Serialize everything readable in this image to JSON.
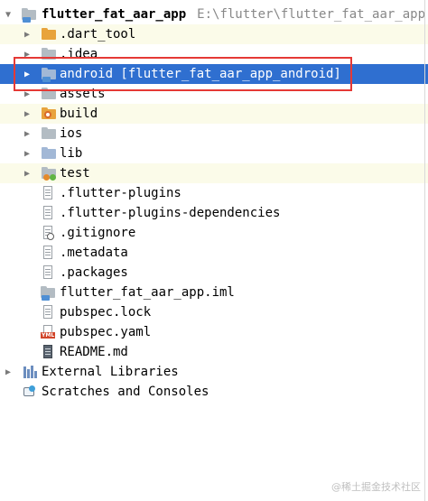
{
  "project_tree": {
    "root": {
      "name": "flutter_fat_aar_app",
      "path": "E:\\flutter\\flutter_fat_aar_app"
    },
    "items": [
      {
        "label": "root",
        "icon": "flutter-module-folder-icon"
      },
      {
        "label": ".dart_tool",
        "icon": "folder-icon"
      },
      {
        "label": ".idea",
        "icon": "idea-folder-icon"
      },
      {
        "label": "android [flutter_fat_aar_app_android]",
        "icon": "module-folder-icon"
      },
      {
        "label": "assets",
        "icon": "folder-icon"
      },
      {
        "label": "build",
        "icon": "build-folder-icon"
      },
      {
        "label": "ios",
        "icon": "folder-icon"
      },
      {
        "label": "lib",
        "icon": "source-folder-icon"
      },
      {
        "label": "test",
        "icon": "test-folder-icon"
      },
      {
        "label": ".flutter-plugins",
        "icon": "text-file-icon"
      },
      {
        "label": ".flutter-plugins-dependencies",
        "icon": "text-file-icon"
      },
      {
        "label": ".gitignore",
        "icon": "ignore-file-icon"
      },
      {
        "label": ".metadata",
        "icon": "text-file-icon"
      },
      {
        "label": ".packages",
        "icon": "text-file-icon"
      },
      {
        "label": "flutter_fat_aar_app.iml",
        "icon": "module-file-icon"
      },
      {
        "label": "pubspec.lock",
        "icon": "text-file-icon"
      },
      {
        "label": "pubspec.yaml",
        "icon": "yaml-file-icon"
      },
      {
        "label": "README.md",
        "icon": "markdown-file-icon"
      },
      {
        "label": "External Libraries",
        "icon": "libraries-icon"
      },
      {
        "label": "Scratches and Consoles",
        "icon": "scratches-icon"
      }
    ],
    "selected_item": "android [flutter_fat_aar_app_android]",
    "yaml_badge": "YML"
  },
  "watermark": "@稀土掘金技术社区",
  "colors": {
    "selection": "#2f6fd0",
    "excluded_tint": "#fbfbe9",
    "annotation_box": "#e53935"
  }
}
